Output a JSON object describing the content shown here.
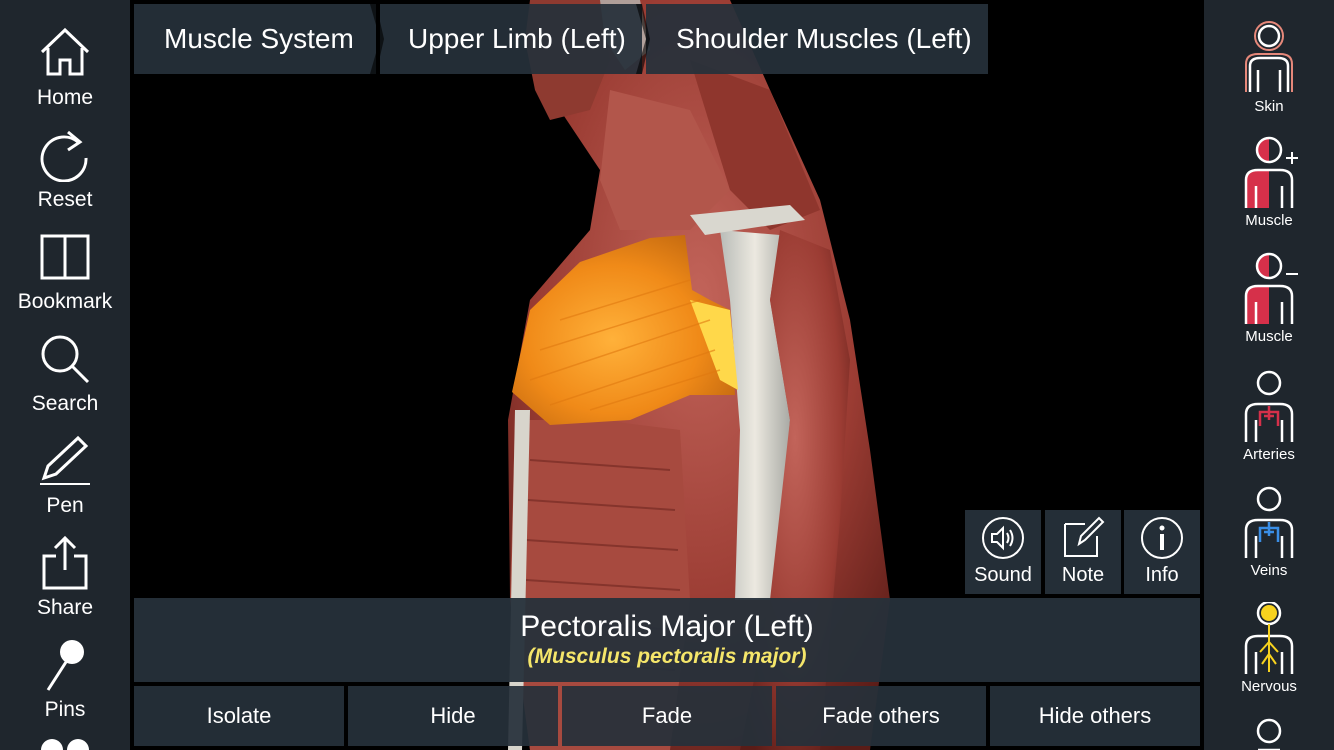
{
  "left_nav": {
    "home": "Home",
    "reset": "Reset",
    "bookmark": "Bookmark",
    "search": "Search",
    "pen": "Pen",
    "share": "Share",
    "pins": "Pins"
  },
  "breadcrumb": [
    "Muscle System",
    "Upper Limb (Left)",
    "Shoulder Muscles (Left)"
  ],
  "actions": {
    "sound": "Sound",
    "note": "Note",
    "info": "Info"
  },
  "selected": {
    "name": "Pectoralis Major (Left)",
    "latin": "(Musculus pectoralis major)"
  },
  "tools": [
    "Isolate",
    "Hide",
    "Fade",
    "Fade others",
    "Hide others"
  ],
  "layers": {
    "skin": "Skin",
    "muscle_add": "Muscle",
    "muscle_remove": "Muscle",
    "arteries": "Arteries",
    "veins": "Veins",
    "nervous": "Nervous"
  },
  "colors": {
    "panel": "#1f262d",
    "muscle": "#a8463a",
    "highlight": "#f29a1f",
    "latin_text": "#f5e66a",
    "artery_red": "#d6304a",
    "vein_blue": "#3a8ee6",
    "nerve_yellow": "#f7d21e"
  }
}
